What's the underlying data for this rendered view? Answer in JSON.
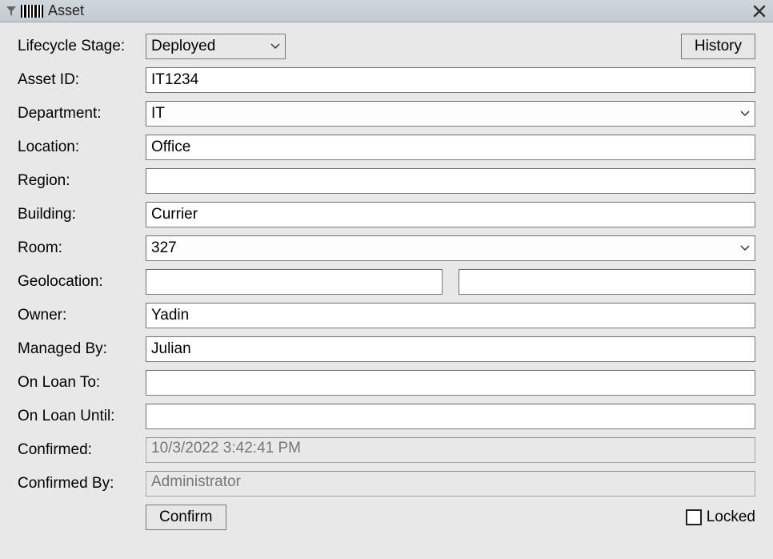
{
  "titlebar": {
    "title": "Asset"
  },
  "buttons": {
    "history": "History",
    "confirm": "Confirm"
  },
  "labels": {
    "lifecycle_stage": "Lifecycle Stage:",
    "asset_id": "Asset ID:",
    "department": "Department:",
    "location": "Location:",
    "region": "Region:",
    "building": "Building:",
    "room": "Room:",
    "geolocation": "Geolocation:",
    "owner": "Owner:",
    "managed_by": "Managed By:",
    "on_loan_to": "On Loan To:",
    "on_loan_until": "On Loan Until:",
    "confirmed": "Confirmed:",
    "confirmed_by": "Confirmed By:",
    "locked": "Locked"
  },
  "values": {
    "lifecycle_stage": "Deployed",
    "asset_id": "IT1234",
    "department": "IT",
    "location": "Office",
    "region": "",
    "building": "Currier",
    "room": "327",
    "geolocation_lat": "",
    "geolocation_lon": "",
    "owner": "Yadin",
    "managed_by": "Julian",
    "on_loan_to": "",
    "on_loan_until": "",
    "confirmed": "10/3/2022 3:42:41 PM",
    "confirmed_by": "Administrator",
    "locked": false
  }
}
